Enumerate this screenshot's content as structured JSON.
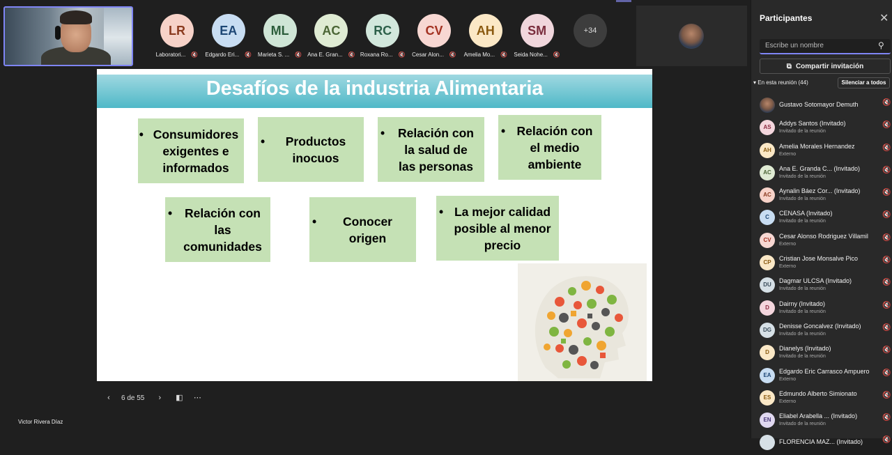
{
  "presenter_name": "Victor Rivera Díaz",
  "self_video": {
    "label": "Victor Rivera Díaz"
  },
  "gallery": [
    {
      "initials": "LR",
      "name": "Laboratori...",
      "bg": "#f6d2c8",
      "fg": "#8a3a1e"
    },
    {
      "initials": "EA",
      "name": "Edgardo Eri...",
      "bg": "#c8ddf2",
      "fg": "#1e4775"
    },
    {
      "initials": "ML",
      "name": "Marieta S. ...",
      "bg": "#cfe5d6",
      "fg": "#2c5d3b"
    },
    {
      "initials": "AC",
      "name": "Ana E. Gran...",
      "bg": "#dfebd3",
      "fg": "#4b6535"
    },
    {
      "initials": "RC",
      "name": "Roxana Ro...",
      "bg": "#d2e7dc",
      "fg": "#2d604a"
    },
    {
      "initials": "CV",
      "name": "Cesar Alon...",
      "bg": "#f7d7d2",
      "fg": "#a33222"
    },
    {
      "initials": "AH",
      "name": "Amelia Mo...",
      "bg": "#fbe8c6",
      "fg": "#8a5a10"
    },
    {
      "initials": "SM",
      "name": "Seida Nohe...",
      "bg": "#f0d6dc",
      "fg": "#7a2d3d"
    }
  ],
  "more_count": "+34",
  "slide": {
    "title": "Desafíos de la industria Alimentaria",
    "boxes": [
      {
        "text": "Consumidores exigentes e informados"
      },
      {
        "text": "Productos inocuos"
      },
      {
        "text": "Relación con la salud de las personas"
      },
      {
        "text": "Relación con el medio ambiente"
      },
      {
        "text": "Relación con las comunidades"
      },
      {
        "text": "Conocer origen"
      },
      {
        "text": "La mejor calidad posible al menor precio"
      }
    ],
    "bullet": "•"
  },
  "controls": {
    "page_indicator": "6 de 55",
    "prev_icon": "chevron-left",
    "next_icon": "chevron-right",
    "more_icon": "ellipsis"
  },
  "panel": {
    "title": "Participantes",
    "search_placeholder": "Escribe un nombre",
    "share_label": "Compartir invitación",
    "section_label": "En esta reunión (44)",
    "mute_all_label": "Silenciar a todos",
    "participants": [
      {
        "initials": "",
        "name": "Gustavo Sotomayor Demuth",
        "sub": "",
        "bg": "#6b5a4a",
        "fg": "#fff",
        "photo": true
      },
      {
        "initials": "AS",
        "name": "Addys Santos (Invitado)",
        "sub": "Invitado de la reunión",
        "bg": "#f4d6dd",
        "fg": "#8c2a40"
      },
      {
        "initials": "AH",
        "name": "Amelia Morales Hernandez",
        "sub": "Externo",
        "bg": "#fbe8c6",
        "fg": "#8a5a10"
      },
      {
        "initials": "AC",
        "name": "Ana E. Granda C...  (Invitado)",
        "sub": "Invitado de la reunión",
        "bg": "#dfebd3",
        "fg": "#4b6535"
      },
      {
        "initials": "AC",
        "name": "Aynalin Báez Cor...  (Invitado)",
        "sub": "Invitado de la reunión",
        "bg": "#f7d2c8",
        "fg": "#8a3a1e"
      },
      {
        "initials": "C",
        "name": "CENASA (Invitado)",
        "sub": "Invitado de la reunión",
        "bg": "#c8ddf2",
        "fg": "#1e4775"
      },
      {
        "initials": "CV",
        "name": "Cesar Alonso Rodriguez Villamil",
        "sub": "Externo",
        "bg": "#f7d7d2",
        "fg": "#a33222"
      },
      {
        "initials": "CP",
        "name": "Cristian Jose Monsalve Pico",
        "sub": "Externo",
        "bg": "#fbe8c6",
        "fg": "#8a5a10"
      },
      {
        "initials": "DU",
        "name": "Dagmar ULCSA (Invitado)",
        "sub": "Invitado de la reunión",
        "bg": "#d6e0e6",
        "fg": "#3a4c5a"
      },
      {
        "initials": "D",
        "name": "Dairny (Invitado)",
        "sub": "Invitado de la reunión",
        "bg": "#f4d6dd",
        "fg": "#8c2a40"
      },
      {
        "initials": "DG",
        "name": "Denisse Goncalvez (Invitado)",
        "sub": "Invitado de la reunión",
        "bg": "#d6e0e6",
        "fg": "#3a4c5a"
      },
      {
        "initials": "D",
        "name": "Dianelys (Invitado)",
        "sub": "Invitado de la reunión",
        "bg": "#fbe8c6",
        "fg": "#8a5a10"
      },
      {
        "initials": "EA",
        "name": "Edgardo Eric Carrasco Ampuero",
        "sub": "Externo",
        "bg": "#c8ddf2",
        "fg": "#1e4775"
      },
      {
        "initials": "ES",
        "name": "Edmundo Alberto Simionato",
        "sub": "Externo",
        "bg": "#fbe8c6",
        "fg": "#8a5a10"
      },
      {
        "initials": "EN",
        "name": "Eliabel Arabella ...  (Invitado)",
        "sub": "Invitado de la reunión",
        "bg": "#e0d8f0",
        "fg": "#4b3a7a"
      },
      {
        "initials": "",
        "name": "FLORENCIA MAZ...  (Invitado)",
        "sub": "",
        "bg": "#d6e0e6",
        "fg": "#3a4c5a"
      }
    ]
  }
}
